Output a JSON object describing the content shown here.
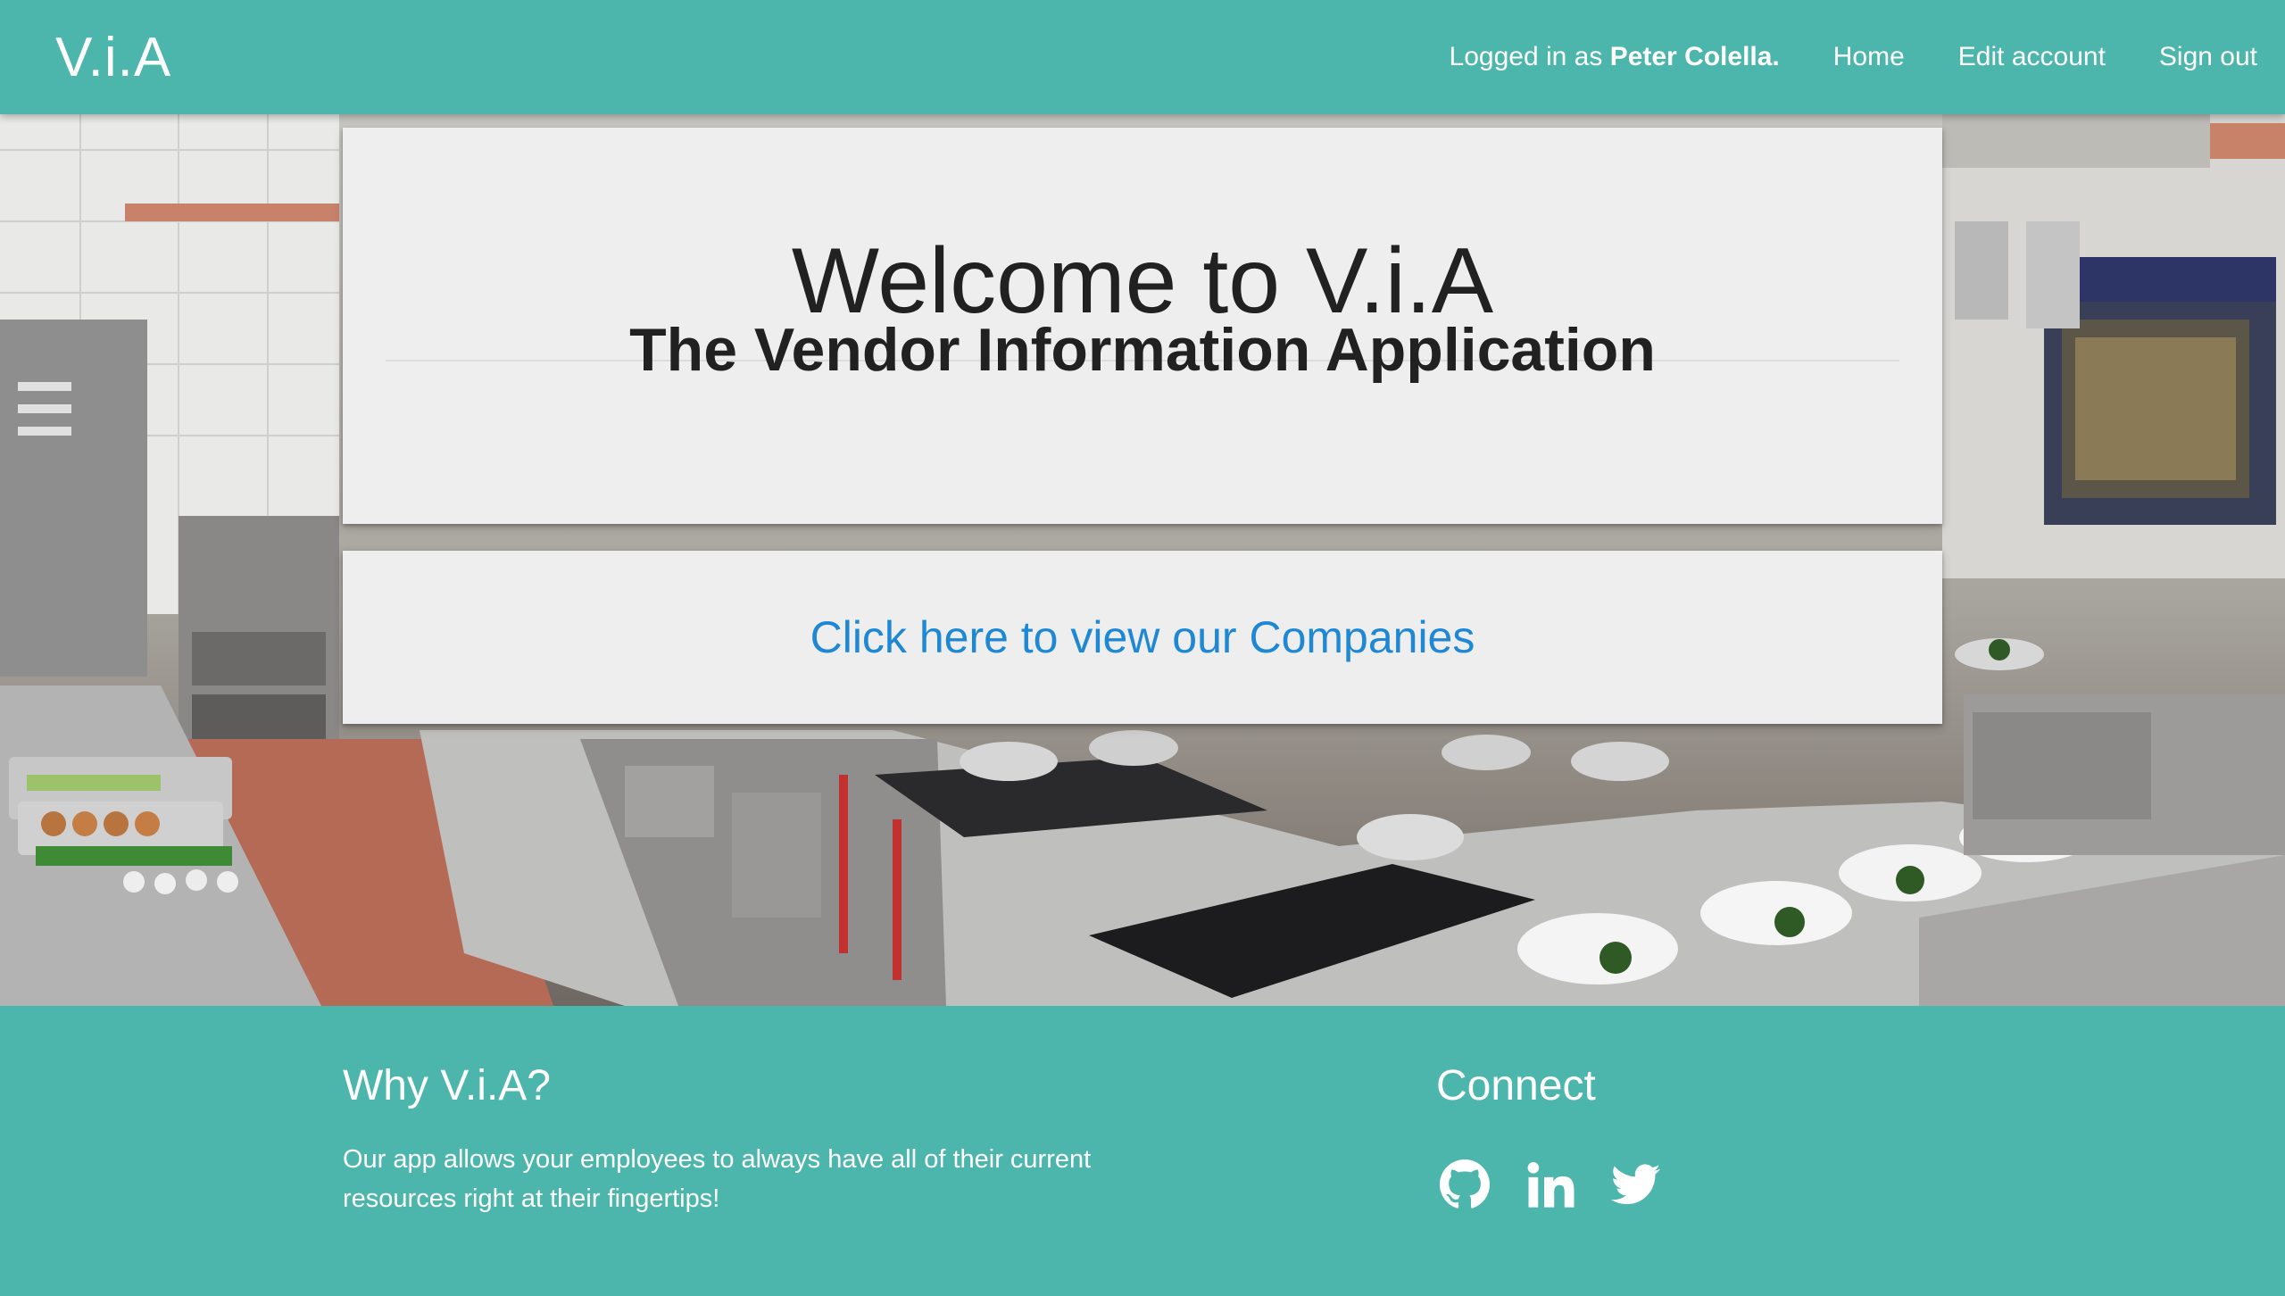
{
  "navbar": {
    "brand": "V.i.A",
    "logged_in_prefix": "Logged in as",
    "user_name": "Peter Colella.",
    "links": [
      "Home",
      "Edit account",
      "Sign out"
    ]
  },
  "hero": {
    "title": "Welcome to V.i.A",
    "subtitle": "The Vendor Information Application",
    "cta_link": "Click here to view our Companies"
  },
  "footer": {
    "why_title": "Why V.i.A?",
    "why_text": "Our app allows your employees to always have all of their current resources right at their fingertips!",
    "connect_title": "Connect",
    "social_icons": [
      "github-icon",
      "linkedin-icon",
      "twitter-icon"
    ]
  },
  "colors": {
    "primary": "#4db6ac",
    "card_bg": "#efeeee",
    "link": "#1e88d5",
    "text_dark": "#212121"
  }
}
